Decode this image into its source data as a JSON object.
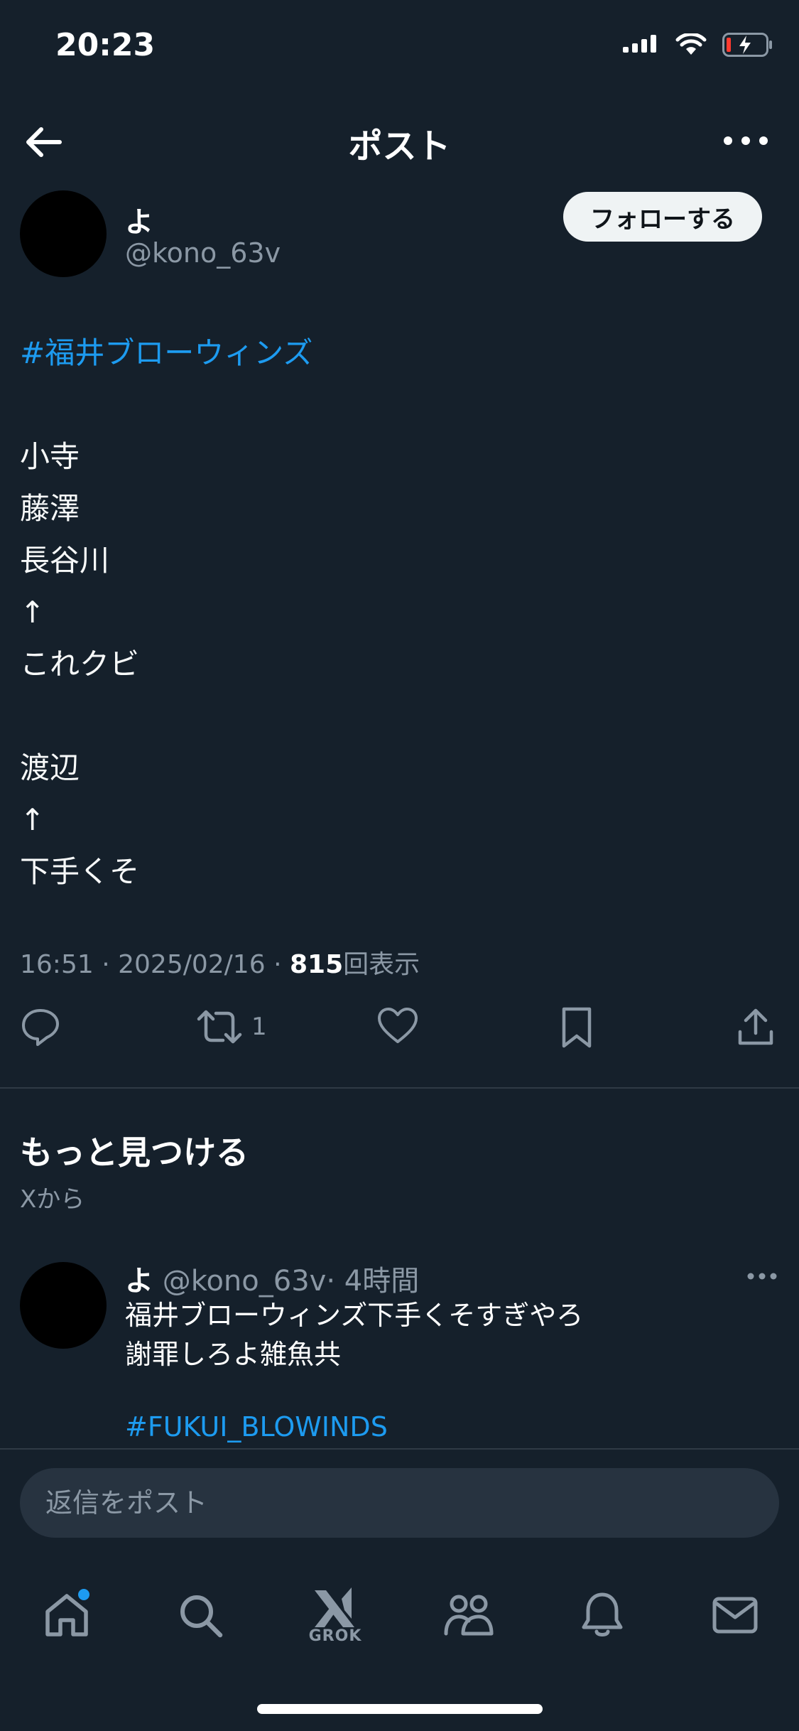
{
  "status_bar": {
    "time": "20:23"
  },
  "header": {
    "title": "ポスト",
    "back_icon": "arrow-left-icon",
    "more_icon": "more-horizontal-icon"
  },
  "author": {
    "name": "よ",
    "handle": "@kono_63v",
    "follow_label": "フォローする"
  },
  "post": {
    "hashtag": "#福井ブローウィンズ",
    "lines": [
      "",
      "小寺",
      "藤澤",
      "長谷川",
      "↑",
      "これクビ",
      "",
      "渡辺",
      "↑",
      "下手くそ"
    ]
  },
  "meta": {
    "time": "16:51",
    "date": "2025/02/16",
    "views": "815",
    "views_label": "回表示",
    "sep": "·"
  },
  "actions": {
    "retweet_count": "1"
  },
  "discover": {
    "title": "もっと見つける",
    "subtitle": "Xから",
    "related": {
      "name": "よ",
      "handle": "@kono_63v",
      "age": "· 4時間",
      "line1": "福井ブローウィンズ下手くそすぎやろ",
      "line2": "謝罪しろよ雑魚共",
      "hashtag": "#FUKUI_BLOWINDS"
    }
  },
  "reply": {
    "placeholder": "返信をポスト"
  },
  "tabbar": {
    "grok_label": "GROK"
  },
  "colors": {
    "background": "#15202b",
    "accent": "#1d9bf0",
    "muted": "#8b98a5"
  }
}
